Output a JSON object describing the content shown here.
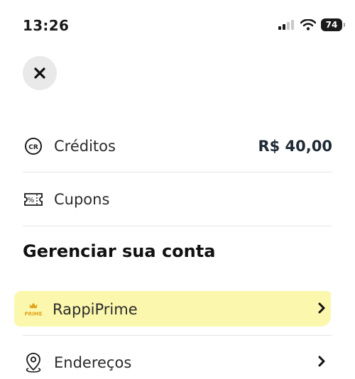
{
  "status_bar": {
    "time": "13:26",
    "battery": "74"
  },
  "close_button": {
    "icon": "close-icon"
  },
  "credits": {
    "label": "Créditos",
    "value": "R$ 40,00",
    "icon": "cr-icon",
    "icon_text": "CR"
  },
  "coupons": {
    "label": "Cupons",
    "icon": "coupon-icon",
    "icon_text": "%"
  },
  "account_section": {
    "title": "Gerenciar sua conta",
    "items": [
      {
        "label": "RappiPrime",
        "icon": "prime-icon",
        "icon_text": "PRIME",
        "highlighted": true
      },
      {
        "label": "Endereços",
        "icon": "location-pin-icon"
      }
    ]
  },
  "colors": {
    "highlight": "#fbf6a4",
    "prime_gold": "#e0a21b"
  }
}
